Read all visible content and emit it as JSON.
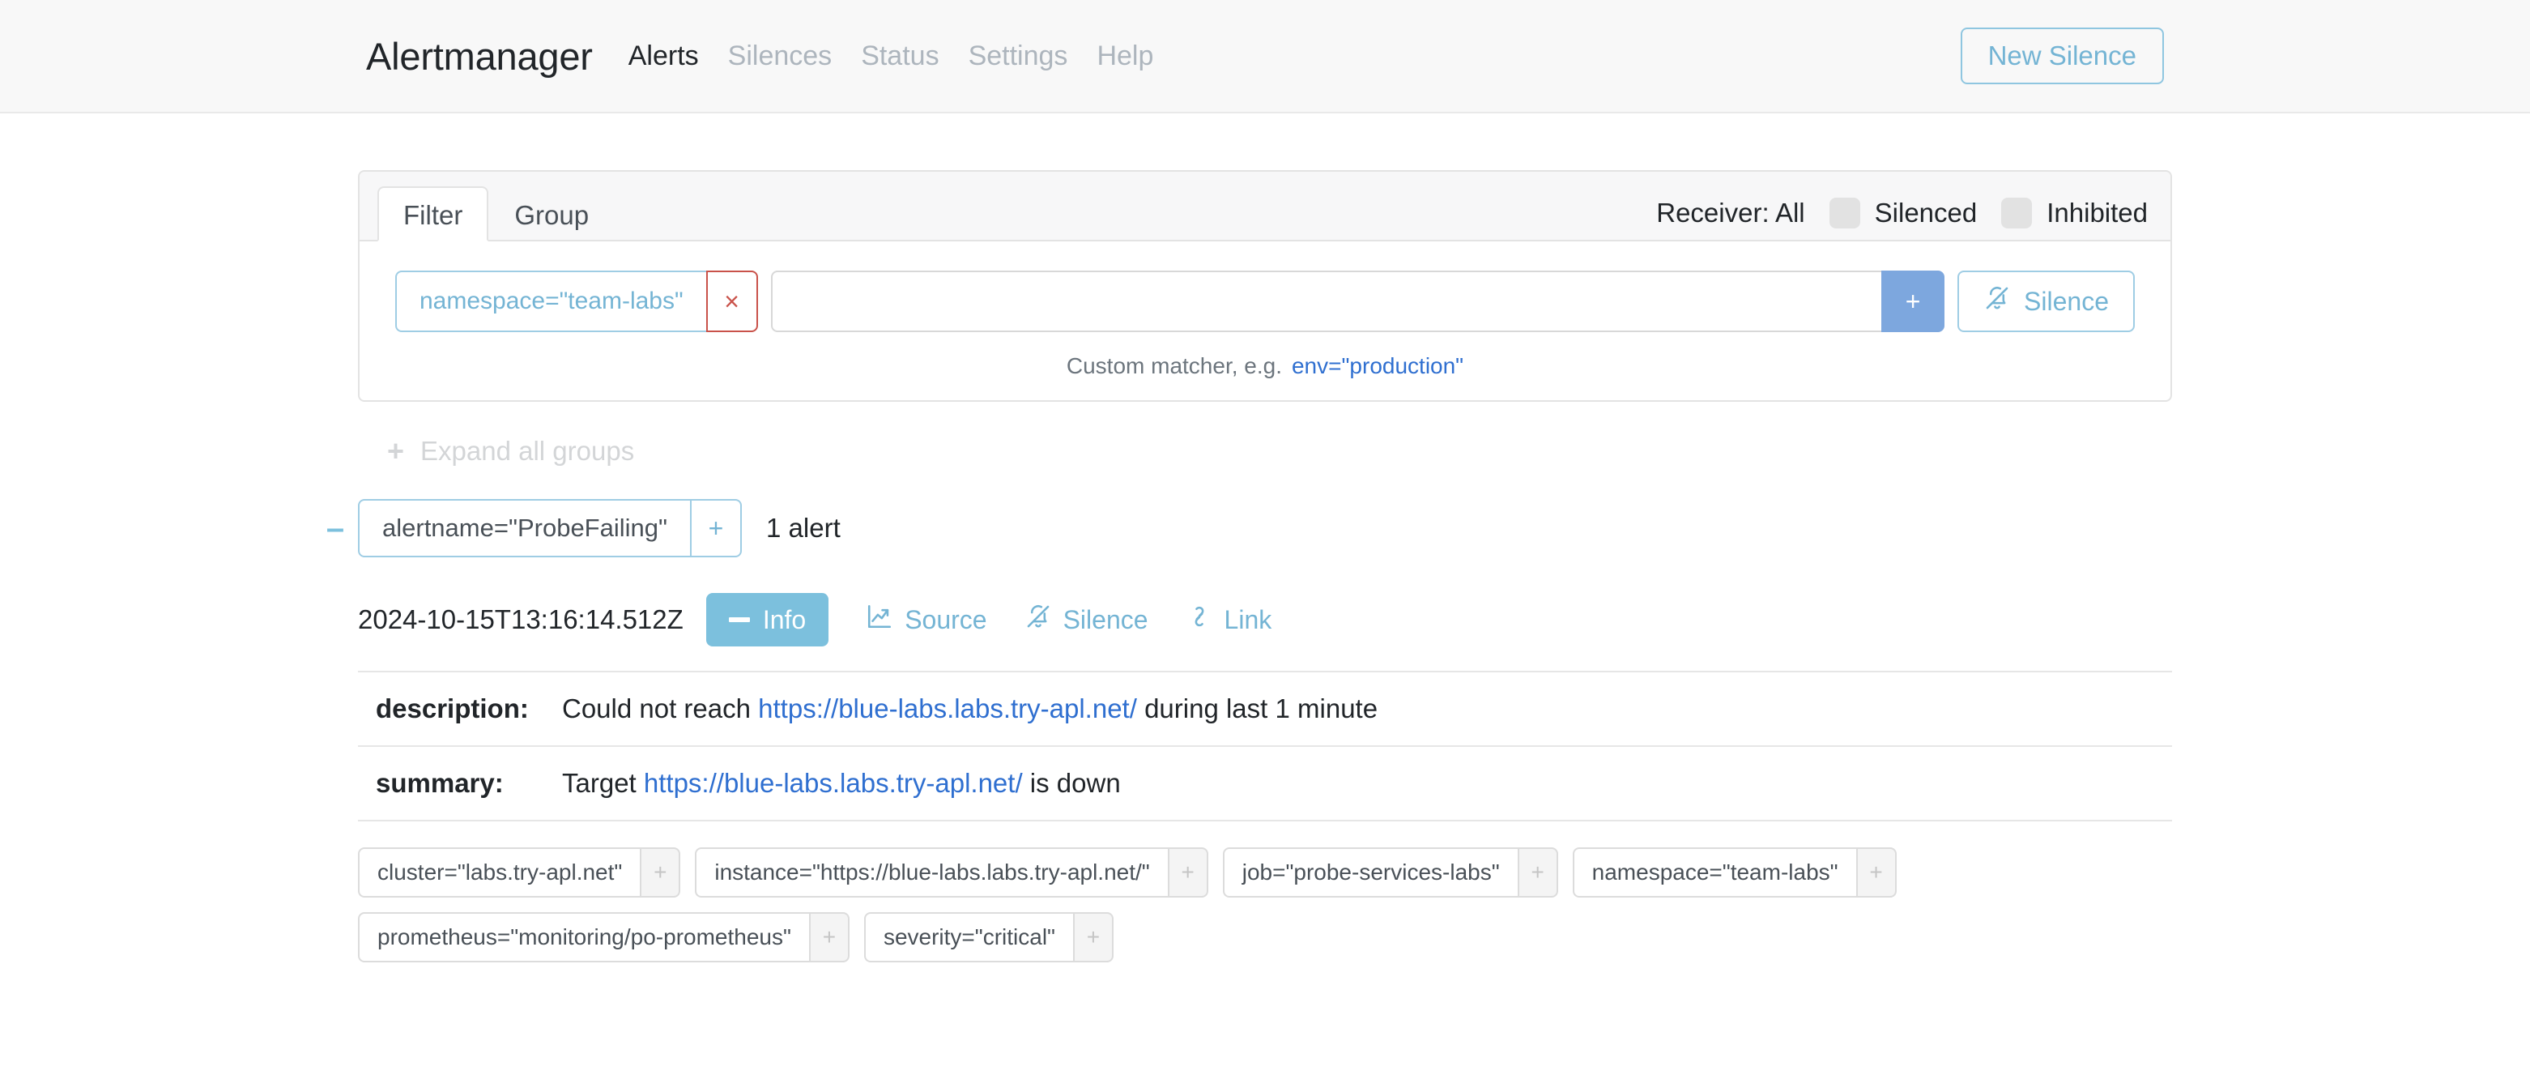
{
  "navbar": {
    "brand": "Alertmanager",
    "links": [
      {
        "label": "Alerts",
        "active": true
      },
      {
        "label": "Silences",
        "active": false
      },
      {
        "label": "Status",
        "active": false
      },
      {
        "label": "Settings",
        "active": false
      },
      {
        "label": "Help",
        "active": false
      }
    ],
    "new_silence_label": "New Silence"
  },
  "filter_card": {
    "tabs": [
      {
        "label": "Filter",
        "active": true
      },
      {
        "label": "Group",
        "active": false
      }
    ],
    "receiver_label": "Receiver: All",
    "toggles": [
      {
        "label": "Silenced",
        "on": false
      },
      {
        "label": "Inhibited",
        "on": false
      }
    ],
    "active_matcher": "namespace=\"team-labs\"",
    "remove_matcher_label": "×",
    "matcher_input_value": "",
    "matcher_input_placeholder": "",
    "add_matcher_label": "+",
    "silence_button_label": "Silence",
    "help_prefix": "Custom matcher, e.g.",
    "help_example": "env=\"production\""
  },
  "expand_all": {
    "label": "Expand all groups",
    "plus": "+"
  },
  "group": {
    "collapse_glyph": "–",
    "matcher": "alertname=\"ProbeFailing\"",
    "plus": "+",
    "count_label": "1 alert"
  },
  "alert": {
    "timestamp": "2024-10-15T13:16:14.512Z",
    "info_label": "Info",
    "actions": [
      {
        "label": "Source",
        "icon": "chart-icon"
      },
      {
        "label": "Silence",
        "icon": "bell-slash-icon"
      },
      {
        "label": "Link",
        "icon": "chain-link-icon"
      }
    ],
    "annotations": [
      {
        "key": "description:",
        "prefix": "Could not reach ",
        "link": "https://blue-labs.labs.try-apl.net/",
        "suffix": " during last 1 minute"
      },
      {
        "key": "summary:",
        "prefix": "Target ",
        "link": "https://blue-labs.labs.try-apl.net/",
        "suffix": " is down"
      }
    ],
    "labels": [
      {
        "text": "cluster=\"labs.try-apl.net\"",
        "plus": "+"
      },
      {
        "text": "instance=\"https://blue-labs.labs.try-apl.net/\"",
        "plus": "+"
      },
      {
        "text": "job=\"probe-services-labs\"",
        "plus": "+"
      },
      {
        "text": "namespace=\"team-labs\"",
        "plus": "+"
      },
      {
        "text": "prometheus=\"monitoring/po-prometheus\"",
        "plus": "+"
      },
      {
        "text": "severity=\"critical\"",
        "plus": "+"
      }
    ]
  },
  "colors": {
    "primary": "#7cc0dd",
    "link": "#2f6fd0",
    "danger": "#c9524a",
    "add_button": "#7da7de",
    "muted": "#adb5bd"
  }
}
